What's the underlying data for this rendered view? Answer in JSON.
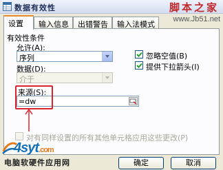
{
  "window": {
    "title": "数据有效性"
  },
  "watermark": {
    "text": "脚本之家",
    "url": "www.Jb51.net"
  },
  "tabs": [
    {
      "label": "设置",
      "active": true
    },
    {
      "label": "输入信息",
      "active": false
    },
    {
      "label": "出错警告",
      "active": false
    },
    {
      "label": "输入法模式",
      "active": false
    }
  ],
  "validation": {
    "group_label": "有效性条件",
    "allow_label": "允许(A):",
    "allow_value": "序列",
    "data_label": "数据(D):",
    "data_value": "介于",
    "ignore_blank": {
      "label": "忽略空值(B)",
      "checked": true
    },
    "dropdown": {
      "label": "提供下拉箭头(I)",
      "checked": true
    },
    "source_label": "来源(S):",
    "source_value": "=dw",
    "apply_all": {
      "label": "对有同样设置的所有其他单元格应用这些更改(P)",
      "checked": false
    }
  },
  "logo": {
    "main": "4syt",
    "suffix": ".com",
    "sub": "电脑软硬件应用网"
  },
  "buttons": {
    "ok_label": "确定",
    "cancel_label": "取消"
  },
  "annotation": {
    "highlight_color": "#d9232e"
  }
}
